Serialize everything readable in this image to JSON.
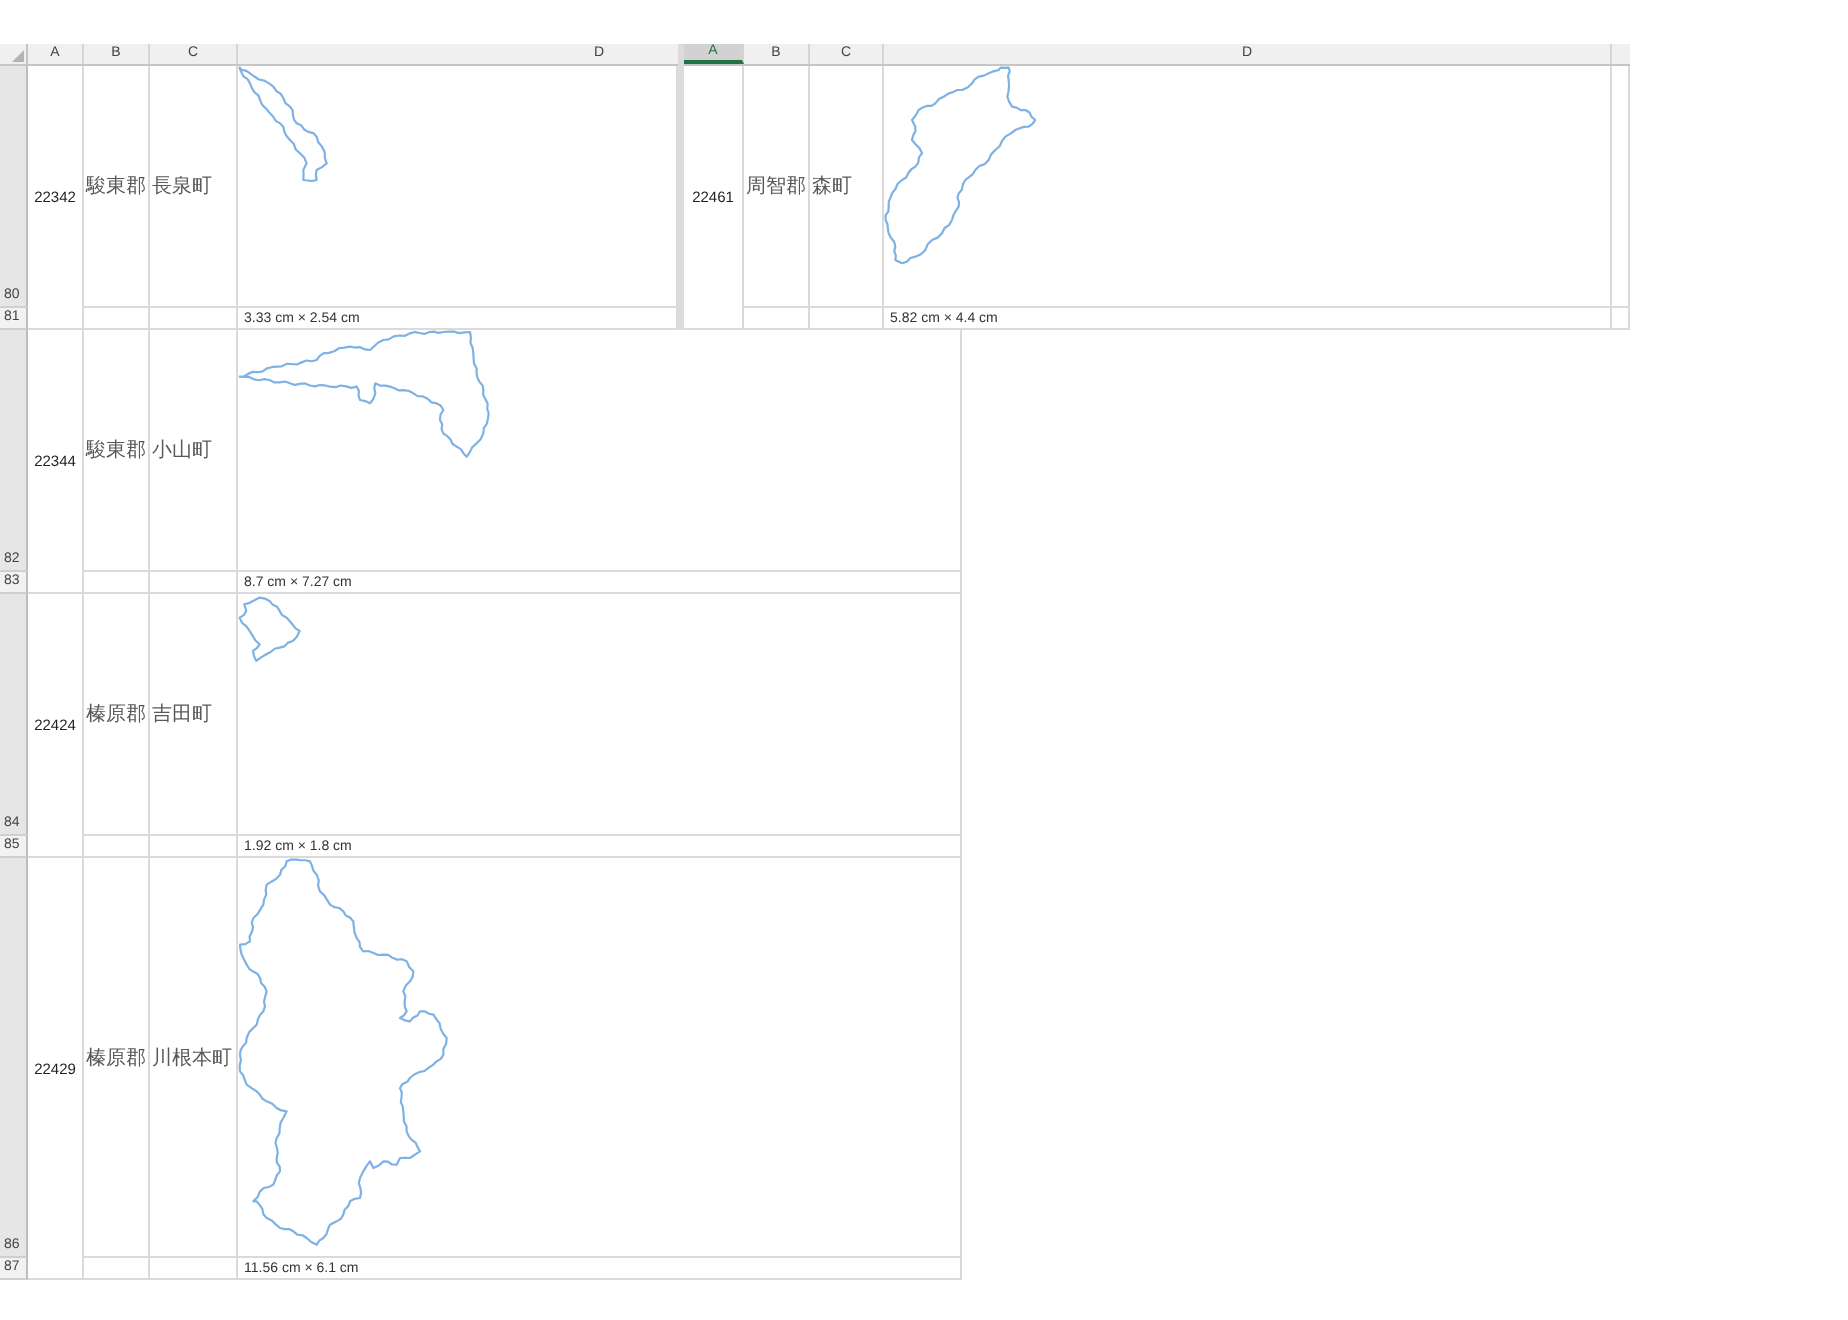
{
  "windows": [
    {
      "columns": [
        {
          "label": "A",
          "selected": false
        },
        {
          "label": "B",
          "selected": false
        },
        {
          "label": "C",
          "selected": false
        },
        {
          "label": "D",
          "selected": false
        }
      ],
      "records": [
        {
          "row_numbers": [
            "80",
            "81"
          ],
          "code": "22342",
          "district": "駿東郡",
          "town": "長泉町",
          "size": "3.33 cm × 2.54 cm"
        },
        {
          "row_numbers": [
            "82",
            "83"
          ],
          "code": "22344",
          "district": "駿東郡",
          "town": "小山町",
          "size": "8.7 cm × 7.27 cm"
        },
        {
          "row_numbers": [
            "84",
            "85"
          ],
          "code": "22424",
          "district": "榛原郡",
          "town": "吉田町",
          "size": "1.92 cm × 1.8 cm"
        },
        {
          "row_numbers": [
            "86",
            "87"
          ],
          "code": "22429",
          "district": "榛原郡",
          "town": "川根本町",
          "size": "11.56 cm × 6.1 cm"
        }
      ]
    },
    {
      "columns": [
        {
          "label": "A",
          "selected": true
        },
        {
          "label": "B",
          "selected": false
        },
        {
          "label": "C",
          "selected": false
        },
        {
          "label": "D",
          "selected": false
        }
      ],
      "records": [
        {
          "code": "22461",
          "district": "周智郡",
          "town": "森町",
          "size": "5.82 cm × 4.4 cm"
        }
      ]
    }
  ]
}
